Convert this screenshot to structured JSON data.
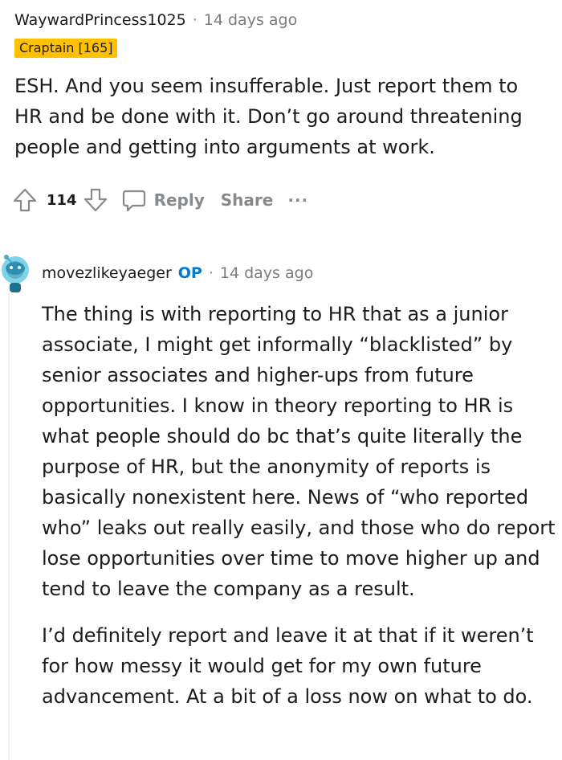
{
  "comment1": {
    "username": "WaywardPrincess1025",
    "separator": "·",
    "timestamp": "14 days ago",
    "flair": "Craptain [165]",
    "body": "ESH. And you seem insufferable. Just report them to HR and be done with it. Don’t go around threatening people and getting into arguments at work.",
    "score": "114",
    "reply_label": "Reply",
    "share_label": "Share",
    "more_label": "···"
  },
  "comment2": {
    "username": "movezlikeyaeger",
    "op_badge": "OP",
    "separator": "·",
    "timestamp": "14 days ago",
    "paragraphs": [
      "The thing is with reporting to HR that as a junior associate, I might get informally “blacklisted” by senior associates and higher-ups from future opportunities. I know in theory reporting to HR is what people should do bc that’s quite literally the purpose of HR, but the anonymity of reports is basically nonexistent here. News of “who reported who” leaks out really easily, and those who do report lose opportunities over time to move higher up and tend to leave the company as a result.",
      "I’d definitely report and leave it at that if it weren’t for how messy it would get for my own future advancement. At a bit of a loss now on what to do."
    ]
  },
  "colors": {
    "flair_bg": "#ffc000",
    "op_blue": "#0079d3",
    "muted": "#878a8c",
    "avatar": "#7fd4e8"
  },
  "icons": [
    "upvote-icon",
    "downvote-icon",
    "reply-icon",
    "avatar-snoo-icon"
  ]
}
